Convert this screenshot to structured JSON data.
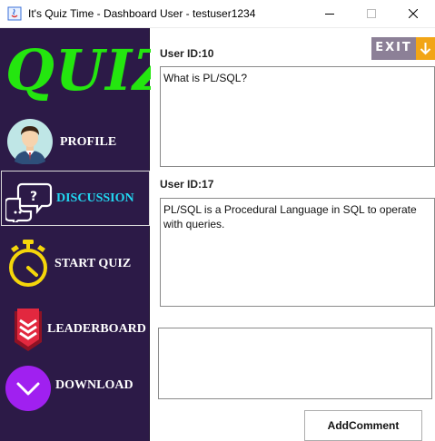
{
  "window": {
    "title": "It's Quiz Time - Dashboard User - testuser1234"
  },
  "sidebar": {
    "logo": "QUIZ",
    "items": [
      {
        "label": "PROFILE",
        "icon": "user-avatar-icon"
      },
      {
        "label": "DISCUSSION",
        "icon": "chat-bubbles-icon",
        "active": true
      },
      {
        "label": "START QUIZ",
        "icon": "stopwatch-icon"
      },
      {
        "label": "LEADERBOARD",
        "icon": "rank-badge-icon"
      },
      {
        "label": "DOWNLOAD",
        "icon": "chevron-down-circle-icon"
      }
    ]
  },
  "main": {
    "exit_label": "EXIT",
    "posts": [
      {
        "user": "User ID:10",
        "text": "What is PL/SQL?"
      },
      {
        "user": "User ID:17",
        "text": "PL/SQL is a Procedural Language in SQL to operate with queries."
      }
    ],
    "comment_input": {
      "value": "",
      "placeholder": ""
    },
    "add_comment_label": "AddComment"
  },
  "colors": {
    "sidebar_bg": "#2c1a47",
    "logo_green": "#24e60f",
    "active_label": "#22d6f0",
    "exit_grey": "#8c8097",
    "exit_orange": "#f2a516",
    "download_purple": "#a020f0"
  }
}
